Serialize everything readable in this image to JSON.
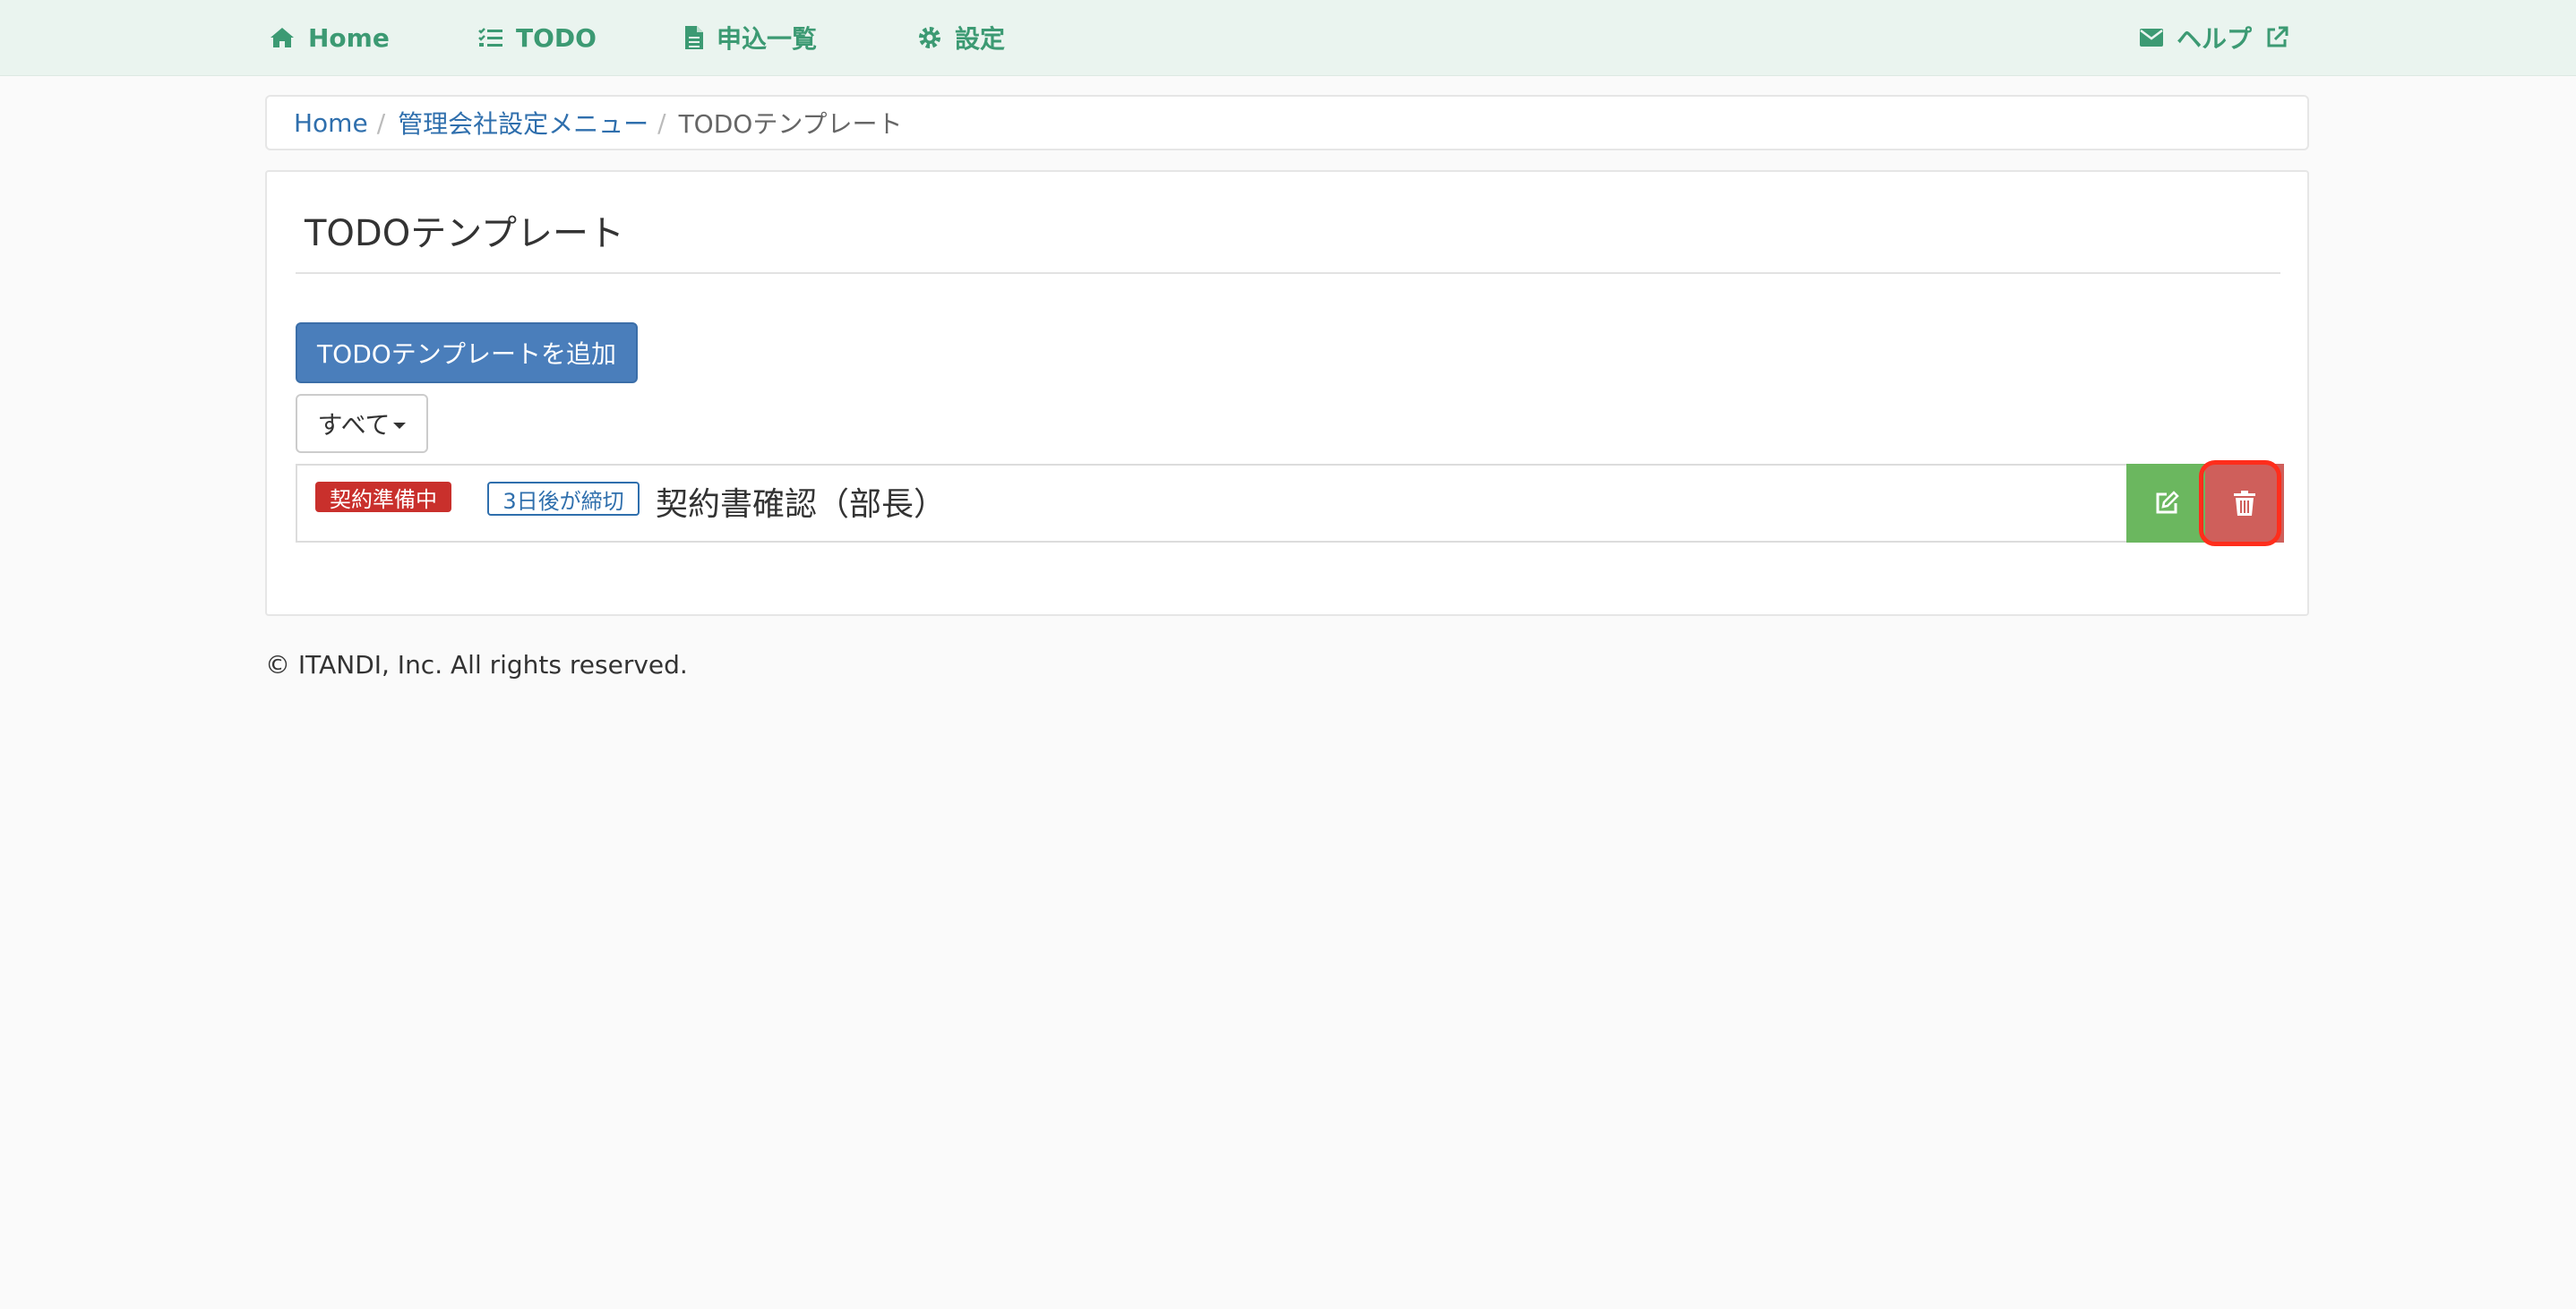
{
  "nav": {
    "home": "Home",
    "todo": "TODO",
    "applications": "申込一覧",
    "settings": "設定",
    "help": "ヘルプ"
  },
  "breadcrumb": {
    "items": [
      "Home",
      "管理会社設定メニュー"
    ],
    "separator": "/",
    "current": "TODOテンプレート"
  },
  "page": {
    "title": "TODOテンプレート",
    "add_button": "TODOテンプレートを追加",
    "filter_button": "すべて"
  },
  "todos": [
    {
      "status": "契約準備中",
      "deadline": "3日後が締切",
      "name": "契約書確認（部長）"
    }
  ],
  "footer": {
    "copyright": "© ITANDI, Inc. All rights reserved."
  },
  "colors": {
    "nav_background": "#eaf4ef",
    "nav_text": "#3c9a73",
    "primary_button": "#4a7ebb",
    "status_badge": "#c9302c",
    "edit_button": "#6bb75f",
    "delete_button": "#cf5f5b",
    "highlight": "#ff2e1c"
  },
  "icons": [
    "home-icon",
    "list-check-icon",
    "file-icon",
    "gear-icon",
    "envelope-icon",
    "external-link-icon",
    "edit-icon",
    "trash-icon"
  ]
}
